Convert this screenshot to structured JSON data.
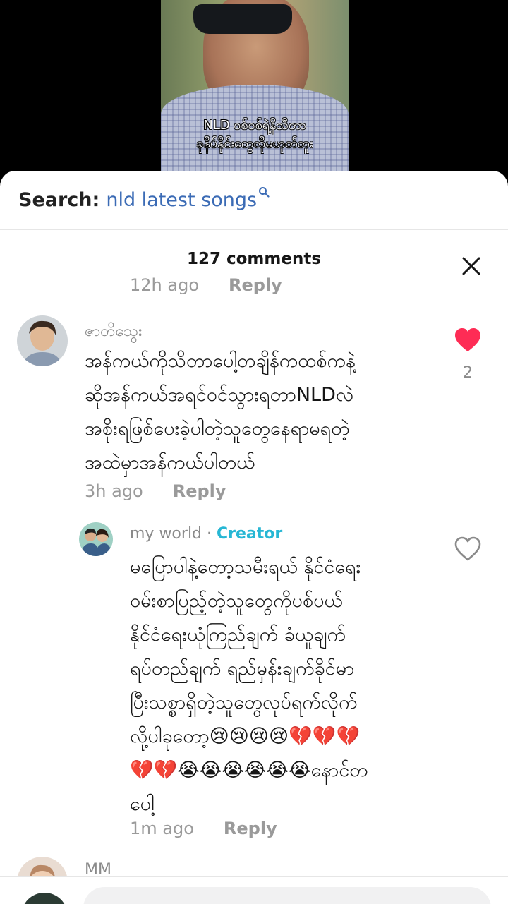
{
  "video": {
    "caption_line1": "NLD ဝစ်ဝစ်ရဲ့နိသီတာ",
    "caption_line2": "ခုနိပ်နိုင်းတွေလိုမဟုတ်ဘူး"
  },
  "search": {
    "prefix": "Search:",
    "query": "nld latest songs",
    "icon": "search-icon"
  },
  "comments_header": {
    "title": "127 comments",
    "close_icon": "close-icon"
  },
  "comments": [
    {
      "time": "12h ago",
      "reply_label": "Reply"
    },
    {
      "username": "ဇာတိသွေး",
      "text_lines": [
        "အန်ကယ်ကိုသိတာပေါ့တချိန်ကထစ်ကနဲ့",
        "ဆိုအန်ကယ်အရင်ဝင်သွားရတာNLDလဲ",
        "အစိုးရဖြစ်ပေးခဲ့ပါတဲ့သူတွေနေရာမရတဲ့",
        "အထဲမှာအန်ကယ်ပါတယ်"
      ],
      "time": "3h ago",
      "reply_label": "Reply",
      "likes": "2",
      "liked": true,
      "like_color": "#fe2c55"
    },
    {
      "username": "my world",
      "separator": " · ",
      "badge": "Creator",
      "badge_color": "#27b7d4",
      "text_lines": [
        "မပြောပါနဲ့တော့သမီးရယ် နိုင်ငံရေး",
        "ဝမ်းစာပြည့်တဲ့သူတွေကိုပစ်ပယ်",
        "နိုင်ငံရေးယုံကြည်ချက် ခံယူချက်",
        "ရပ်တည်ချက် ရည်မှန်းချက်ခိုင်မာ",
        "ပြီးသစ္စာရှိတဲ့သူတွေလုပ်ရက်လိုက်",
        "လို့ပါခုတော့😢😢😢😢💔💔💔",
        "💔💔😭😭😭😭😭😭နောင်တ",
        "ပေါ့"
      ],
      "time": "1m ago",
      "reply_label": "Reply",
      "liked": false
    },
    {
      "username": "MM"
    }
  ]
}
